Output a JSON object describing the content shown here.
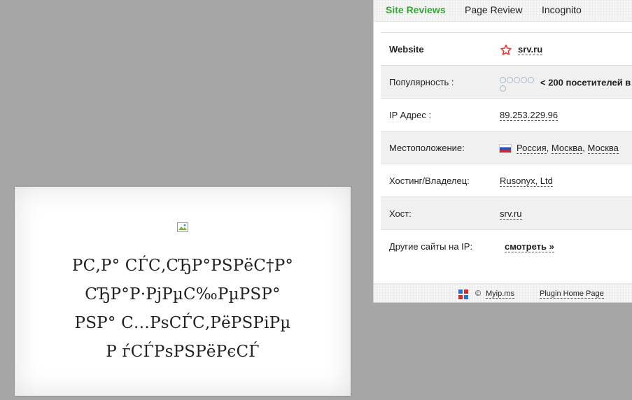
{
  "card": {
    "lines": [
      "РС‚Р° СЃС‚СЂР°РЅРёС†Р°",
      "СЂР°Р·РјРµС‰РµРЅР°",
      "РЅР° С…РѕСЃС‚РёРЅРіРµ",
      "Р ѓСЃРѕРЅРёРєСЃ"
    ],
    "broken_image_icon": "broken-image-icon"
  },
  "panel": {
    "tabs": [
      "Site Reviews",
      "Page Review",
      "Incognito"
    ],
    "active_tab": "Site Reviews",
    "rows": {
      "website": {
        "label": "Website",
        "value": "srv.ru"
      },
      "popularity": {
        "label": "Популярность :",
        "value": "< 200 посетителей в"
      },
      "ip": {
        "label": "IP Адрес :",
        "value": "89.253.229.96"
      },
      "location": {
        "label": "Местоположение:",
        "country": "Россия",
        "region": "Москва",
        "city": "Москва"
      },
      "hosting": {
        "label": "Хостинг/Владелец:",
        "value": "Rusonyx, Ltd"
      },
      "host": {
        "label": "Хост:",
        "value": "srv.ru"
      },
      "other_sites": {
        "label": "Другие сайты на IP:",
        "value": "смотреть »"
      }
    },
    "footer": {
      "copyright": "©",
      "myip": "Myip.ms",
      "plugin": "Plugin Home Page"
    }
  },
  "colors": {
    "background": "#a6a6a6",
    "active_tab": "#3aa33a"
  }
}
